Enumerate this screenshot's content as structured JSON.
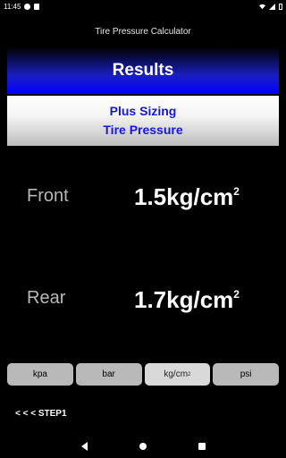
{
  "status_bar": {
    "time": "11:45"
  },
  "app": {
    "title": "Tire Pressure Calculator"
  },
  "results": {
    "title": "Results",
    "subtitle_line1": "Plus Sizing",
    "subtitle_line2": "Tire Pressure"
  },
  "front": {
    "label": "Front",
    "value": "1.5kg/cm",
    "exp": "2"
  },
  "rear": {
    "label": "Rear",
    "value": "1.7kg/cm",
    "exp": "2"
  },
  "units": {
    "options": [
      {
        "label": "kpa",
        "selected": false
      },
      {
        "label": "bar",
        "selected": false
      },
      {
        "label": "kg/cm",
        "sup": "2",
        "selected": true
      },
      {
        "label": "psi",
        "selected": false
      }
    ]
  },
  "navigation": {
    "step_back_label": "< < < STEP1"
  }
}
